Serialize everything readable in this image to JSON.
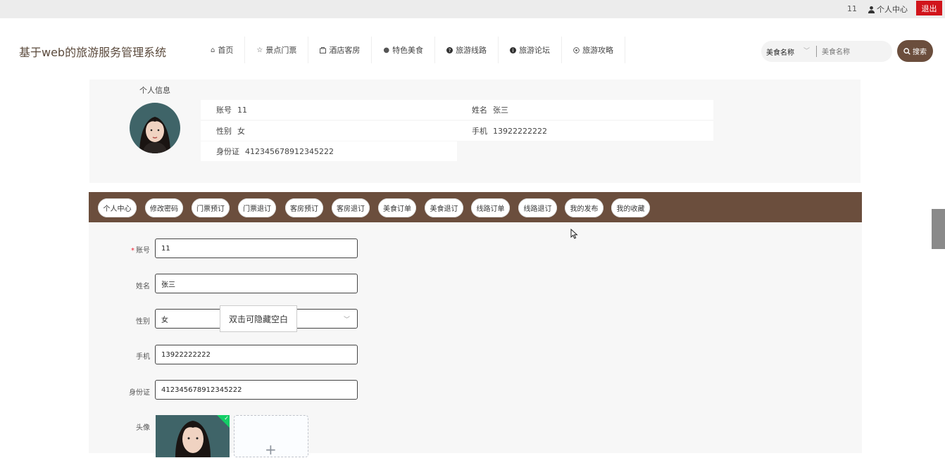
{
  "topbar": {
    "user_id": "11",
    "personal_center": "个人中心",
    "logout": "退出"
  },
  "header": {
    "site_title": "基于web的旅游服务管理系统",
    "nav": [
      {
        "label": "首页",
        "icon": "home-icon"
      },
      {
        "label": "景点门票",
        "icon": "star-icon"
      },
      {
        "label": "酒店客房",
        "icon": "bag-icon"
      },
      {
        "label": "特色美食",
        "icon": "dot-icon"
      },
      {
        "label": "旅游线路",
        "icon": "question-icon"
      },
      {
        "label": "旅游论坛",
        "icon": "info-icon"
      },
      {
        "label": "旅游攻略",
        "icon": "compass-icon"
      }
    ],
    "search": {
      "select_value": "美食名称",
      "placeholder": "美食名称",
      "button": "搜索"
    }
  },
  "profile": {
    "title": "个人信息",
    "account_label": "账号",
    "account_value": "11",
    "name_label": "姓名",
    "name_value": "张三",
    "gender_label": "性别",
    "gender_value": "女",
    "phone_label": "手机",
    "phone_value": "13922222222",
    "idcard_label": "身份证",
    "idcard_value": "412345678912345222"
  },
  "tabs": [
    "个人中心",
    "修改密码",
    "门票预订",
    "门票退订",
    "客房预订",
    "客房退订",
    "美食订单",
    "美食退订",
    "线路订单",
    "线路退订",
    "我的发布",
    "我的收藏"
  ],
  "form": {
    "account_label": "账号",
    "account_value": "11",
    "name_label": "姓名",
    "name_value": "张三",
    "gender_label": "性别",
    "gender_value": "女",
    "phone_label": "手机",
    "phone_value": "13922222222",
    "idcard_label": "身份证",
    "idcard_value": "412345678912345222",
    "avatar_label": "头像",
    "required_mark": "*",
    "tooltip": "双击可隐藏空白"
  },
  "colors": {
    "brand": "#6b4e3d",
    "logout": "#d1141b",
    "success": "#13ce66"
  }
}
